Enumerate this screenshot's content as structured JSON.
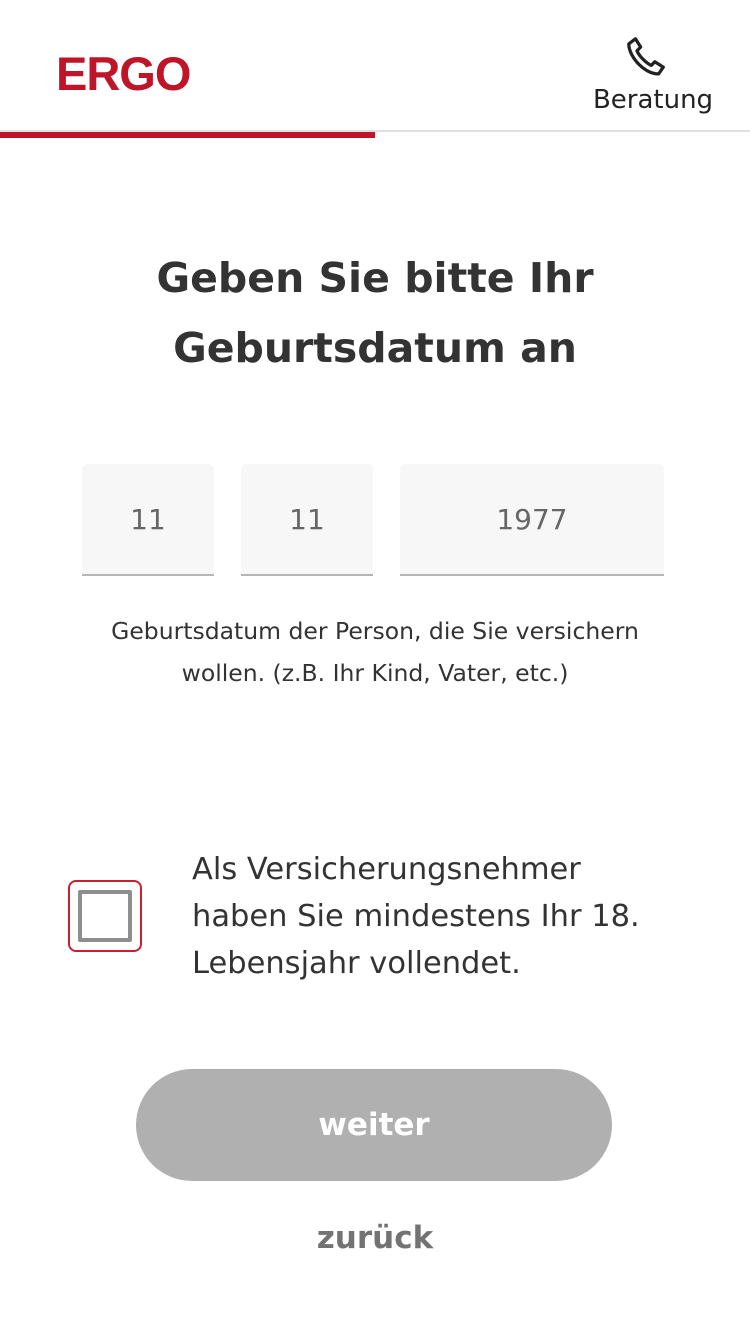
{
  "header": {
    "logo_text": "ERGO",
    "advice_label": "Beratung",
    "advice_icon": "phone-icon",
    "progress_percent": 50
  },
  "main": {
    "title_line1": "Geben Sie bitte Ihr",
    "title_line2": "Geburtsdatum an",
    "birthdate": {
      "day": "11",
      "month": "11",
      "year": "1977"
    },
    "hint_line1": "Geburtsdatum der Person, die Sie versichern",
    "hint_line2": "wollen. (z.B. Ihr Kind, Vater, etc.)",
    "confirmation": {
      "checked": false,
      "label_line1": "Als Versicherungsnehmer",
      "label_line2": "haben Sie mindestens Ihr 18.",
      "label_line3": "Lebensjahr vollendet."
    }
  },
  "actions": {
    "next_label": "weiter",
    "back_label": "zurück"
  },
  "colors": {
    "brand": "#bf1528",
    "button_disabled": "#b0b0b0"
  }
}
